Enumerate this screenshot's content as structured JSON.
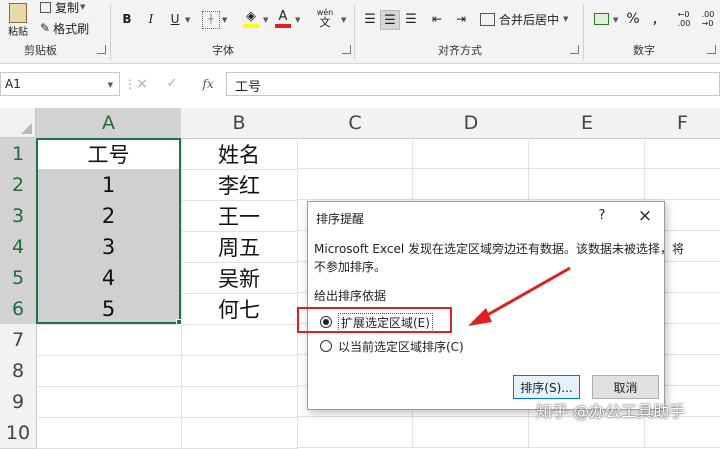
{
  "ribbon": {
    "clipboard": {
      "title": "剪贴板",
      "paste": "粘贴",
      "copy": "复制",
      "format_painter": "格式刷"
    },
    "font": {
      "title": "字体",
      "bold": "B",
      "italic": "I",
      "underline": "U",
      "wen": "wén"
    },
    "alignment": {
      "title": "对齐方式",
      "merge_center": "合并后居中"
    },
    "number": {
      "title": "数字",
      "percent": "%",
      "comma": ","
    }
  },
  "formula_bar": {
    "name_box": "A1",
    "cancel": "×",
    "enter": "✓",
    "fx": "fx",
    "content": "工号"
  },
  "sheet": {
    "columns": [
      "A",
      "B",
      "C",
      "D",
      "E",
      "F"
    ],
    "rows": [
      "1",
      "2",
      "3",
      "4",
      "5",
      "6",
      "7",
      "8",
      "9",
      "10"
    ],
    "col_a": [
      "工号",
      "1",
      "2",
      "3",
      "4",
      "5"
    ],
    "col_b": [
      "姓名",
      "李红",
      "王一",
      "周五",
      "吴新",
      "何七"
    ]
  },
  "dialog": {
    "title": "排序提醒",
    "help": "?",
    "close": "×",
    "message_line1": "Microsoft Excel 发现在选定区域旁边还有数据。该数据未被选择，将",
    "message_line2": "不参加排序。",
    "group_label": "给出排序依据",
    "option_expand": "扩展选定区域(E)",
    "option_current": "以当前选定区域排序(C)",
    "sort_button": "排序(S)...",
    "cancel_button": "取消",
    "selected_option": "option_expand"
  },
  "watermark": "知乎 @办公工具助手",
  "colors": {
    "selection_border": "#217346",
    "highlight": "#e02020",
    "selected_cell": "#d0d0d0",
    "selected_header": "#d2d2d2"
  }
}
